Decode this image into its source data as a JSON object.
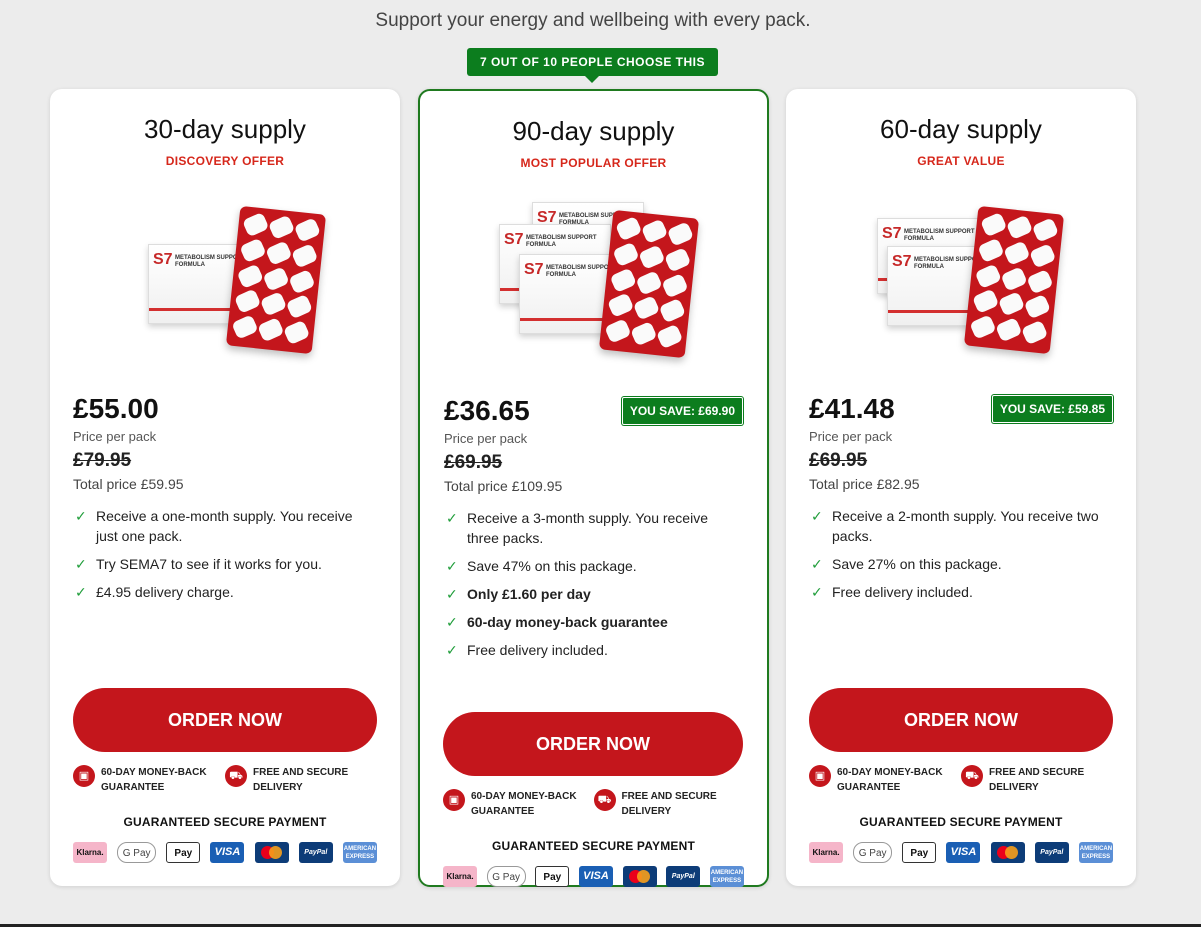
{
  "header": {
    "subtitle": "Support your energy and wellbeing with every pack."
  },
  "popular_badge": "7 OUT OF 10 PEOPLE CHOOSE THIS",
  "colors": {
    "accent_red": "#c4161c",
    "offer_red": "#d6271b",
    "save_green": "#0c7d1e",
    "check_green": "#1f9d3a",
    "page_bg": "#ececec"
  },
  "plans": [
    {
      "title": "30-day supply",
      "offer": "DISCOVERY OFFER",
      "product_image": "1 box + blister pack",
      "price": "£55.00",
      "price_label": "Price per pack",
      "save": "",
      "old_price": "£79.95",
      "total": "Total price £59.95",
      "features": [
        {
          "text": "Receive a one-month supply. You receive just one pack.",
          "bold": false
        },
        {
          "text": "Try SEMA7 to see if it works for you.",
          "bold": false
        },
        {
          "text": "£4.95 delivery charge.",
          "bold": false
        }
      ],
      "cta": "ORDER NOW",
      "guarantee": "60-DAY MONEY-BACK GUARANTEE",
      "delivery": "FREE AND SECURE DELIVERY",
      "secure_title": "GUARANTEED SECURE PAYMENT"
    },
    {
      "title": "90-day supply",
      "offer": "MOST POPULAR OFFER",
      "product_image": "3 boxes + blister pack",
      "price": "£36.65",
      "price_label": "Price per pack",
      "save": "YOU SAVE: £69.90",
      "old_price": "£69.95",
      "total": "Total price £109.95",
      "features": [
        {
          "text": "Receive a 3-month supply. You receive three packs.",
          "bold": false
        },
        {
          "text": "Save 47% on this package.",
          "bold": false
        },
        {
          "text": "Only £1.60 per day",
          "bold": true
        },
        {
          "text": "60-day money-back guarantee",
          "bold": true
        },
        {
          "text": "Free delivery included.",
          "bold": false
        }
      ],
      "cta": "ORDER NOW",
      "guarantee": "60-DAY MONEY-BACK GUARANTEE",
      "delivery": "FREE AND SECURE DELIVERY",
      "secure_title": "GUARANTEED SECURE PAYMENT"
    },
    {
      "title": "60-day supply",
      "offer": "GREAT VALUE",
      "product_image": "2 boxes + blister pack",
      "price": "£41.48",
      "price_label": "Price per pack",
      "save": "YOU SAVE: £59.85",
      "old_price": "£69.95",
      "total": "Total price £82.95",
      "features": [
        {
          "text": "Receive a 2-month supply. You receive two packs.",
          "bold": false
        },
        {
          "text": "Save 27% on this package.",
          "bold": false
        },
        {
          "text": "Free delivery included.",
          "bold": false
        }
      ],
      "cta": "ORDER NOW",
      "guarantee": "60-DAY MONEY-BACK GUARANTEE",
      "delivery": "FREE AND SECURE DELIVERY",
      "secure_title": "GUARANTEED SECURE PAYMENT"
    }
  ],
  "product_box": {
    "logo": "S7",
    "name_line1": "METABOLISM SUPPORT",
    "name_line2": "FORMULA"
  },
  "payment_methods": [
    {
      "id": "klarna",
      "label": "Klarna."
    },
    {
      "id": "gpay",
      "label": "G Pay"
    },
    {
      "id": "apple",
      "label": " Pay"
    },
    {
      "id": "visa",
      "label": "VISA"
    },
    {
      "id": "mc",
      "label": ""
    },
    {
      "id": "paypal",
      "label": "PayPal"
    },
    {
      "id": "amex",
      "label": "AMERICAN EXPRESS"
    }
  ]
}
